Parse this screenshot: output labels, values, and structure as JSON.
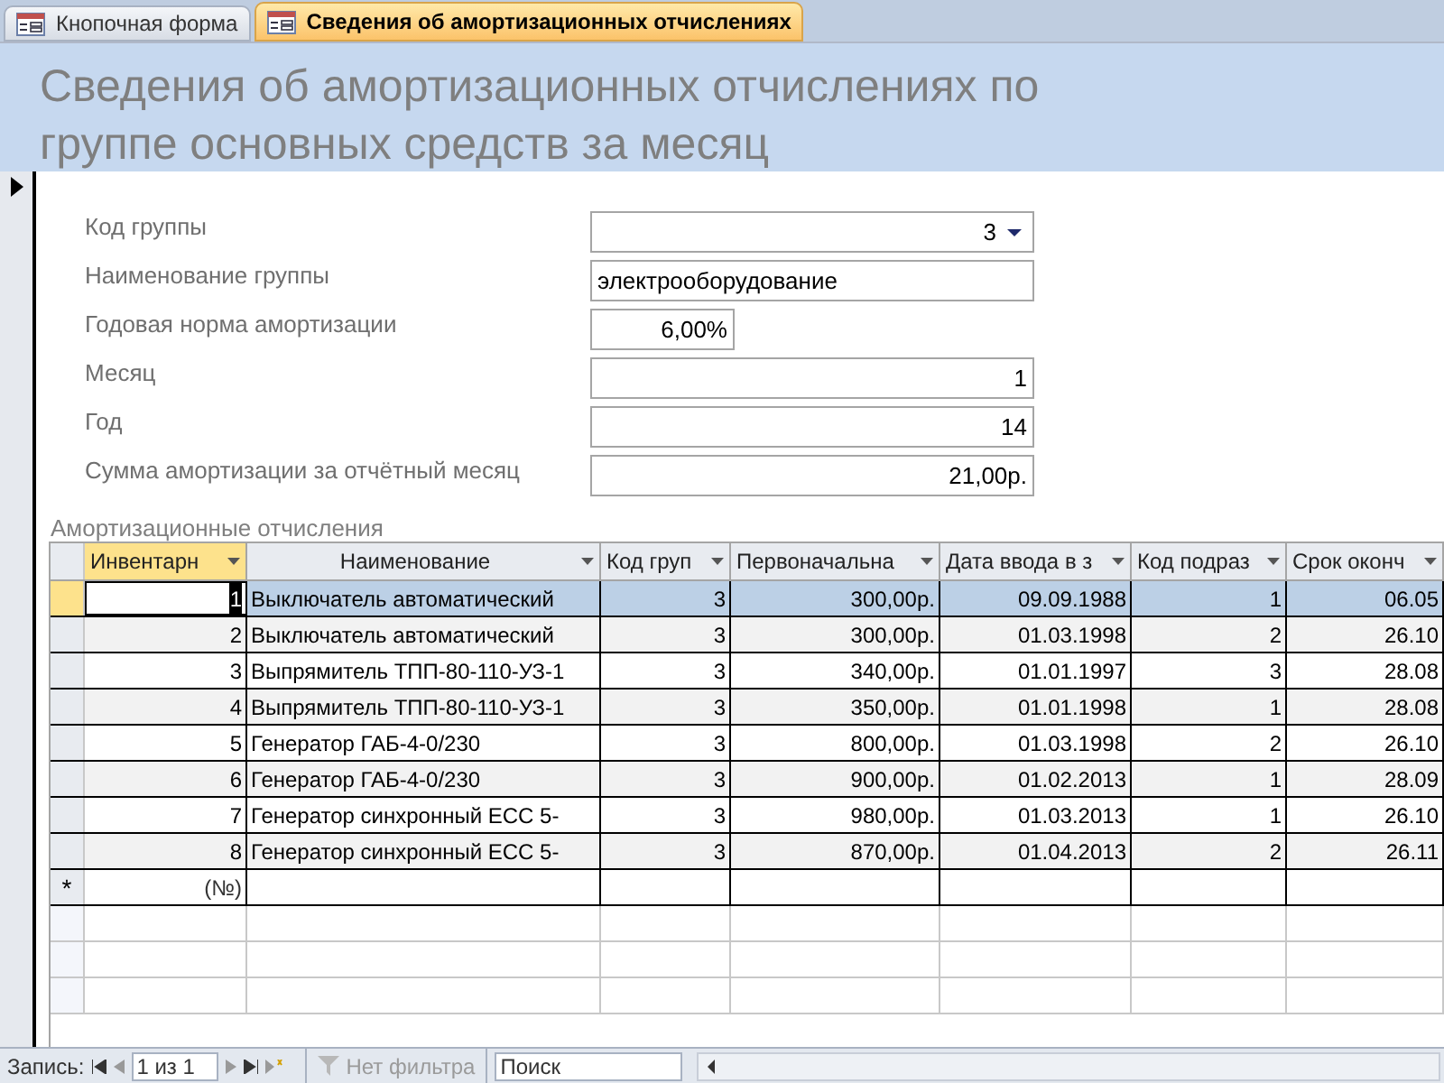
{
  "tabs": [
    {
      "label": "Кнопочная форма",
      "selected": false
    },
    {
      "label": "Сведения об амортизационных отчислениях",
      "selected": true
    }
  ],
  "header": {
    "title": "Сведения об амортизационных отчислениях по группе основных средств за месяц"
  },
  "fields": [
    {
      "label": "Код группы",
      "value": "3",
      "kind": "combo"
    },
    {
      "label": "Наименование группы",
      "value": "электрооборудование",
      "kind": "text"
    },
    {
      "label": "Годовая норма амортизации",
      "value": "6,00%",
      "kind": "percent"
    },
    {
      "label": "Месяц",
      "value": "1",
      "kind": "number"
    },
    {
      "label": "Год",
      "value": "14",
      "kind": "number"
    },
    {
      "label": "Сумма амортизации за отчётный месяц",
      "value": "21,00р.",
      "kind": "number"
    }
  ],
  "subform": {
    "label": "Амортизационные отчисления",
    "columns": [
      {
        "label": "Инвентарн"
      },
      {
        "label": "Наименование"
      },
      {
        "label": "Код груп"
      },
      {
        "label": "Первоначальна"
      },
      {
        "label": "Дата ввода в з"
      },
      {
        "label": "Код подраз"
      },
      {
        "label": "Срок оконч"
      }
    ],
    "rows": [
      {
        "selected": true,
        "cells": [
          "1",
          "Выключатель автоматический",
          "3",
          "300,00р.",
          "09.09.1988",
          "1",
          "06.05"
        ]
      },
      {
        "selected": false,
        "cells": [
          "2",
          "Выключатель автоматический",
          "3",
          "300,00р.",
          "01.03.1998",
          "2",
          "26.10"
        ]
      },
      {
        "selected": false,
        "cells": [
          "3",
          "Выпрямитель ТПП-80-110-УЗ-1",
          "3",
          "340,00р.",
          "01.01.1997",
          "3",
          "28.08"
        ]
      },
      {
        "selected": false,
        "cells": [
          "4",
          "Выпрямитель ТПП-80-110-УЗ-1",
          "3",
          "350,00р.",
          "01.01.1998",
          "1",
          "28.08"
        ]
      },
      {
        "selected": false,
        "cells": [
          "5",
          "Генератор ГАБ-4-0/230",
          "3",
          "800,00р.",
          "01.03.1998",
          "2",
          "26.10"
        ]
      },
      {
        "selected": false,
        "cells": [
          "6",
          "Генератор ГАБ-4-0/230",
          "3",
          "900,00р.",
          "01.02.2013",
          "1",
          "28.09"
        ]
      },
      {
        "selected": false,
        "cells": [
          "7",
          "Генератор синхронный ЕСС 5-",
          "3",
          "980,00р.",
          "01.03.2013",
          "1",
          "26.10"
        ]
      },
      {
        "selected": false,
        "cells": [
          "8",
          "Генератор синхронный ЕСС 5-",
          "3",
          "870,00р.",
          "01.04.2013",
          "2",
          "26.11"
        ]
      }
    ],
    "new_row": {
      "marker": "*",
      "placeholder": "(№)"
    }
  },
  "record_nav": {
    "label": "Запись:",
    "position": "1 из 1",
    "filter": "Нет фильтра",
    "search": {
      "placeholder": "Поиск"
    }
  }
}
